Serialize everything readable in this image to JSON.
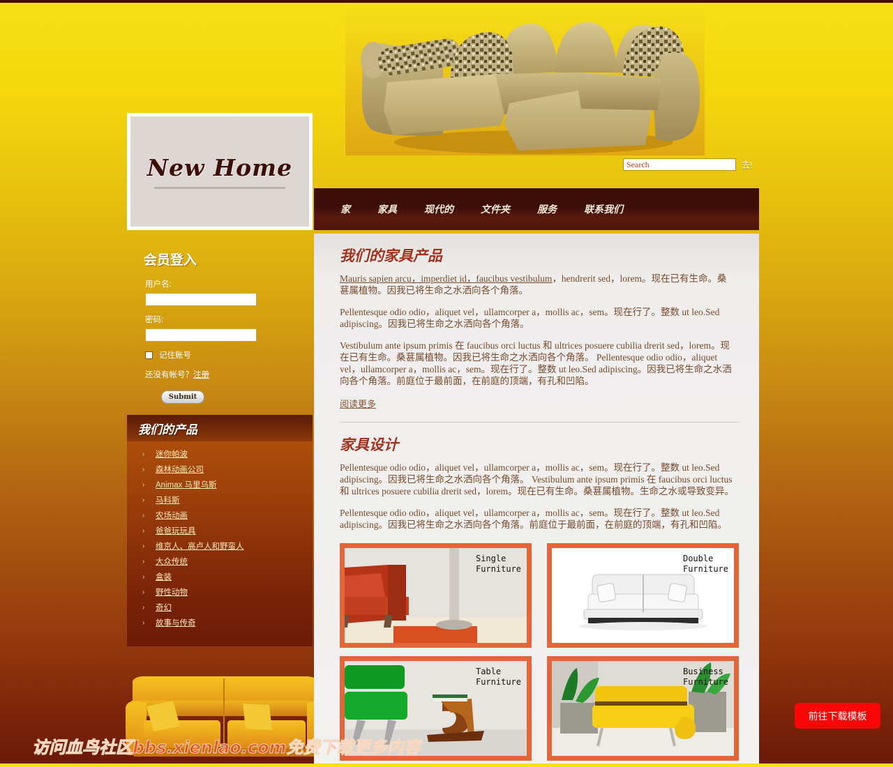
{
  "site": {
    "logo_text": "New Home",
    "top_accent_color": "#4a0f08"
  },
  "search": {
    "placeholder": "Search",
    "value": "",
    "go_label": "去!"
  },
  "nav": {
    "items": [
      {
        "label": "家"
      },
      {
        "label": "家具"
      },
      {
        "label": "现代的"
      },
      {
        "label": "文件夹"
      },
      {
        "label": "服务"
      },
      {
        "label": "联系我们"
      }
    ]
  },
  "login": {
    "title": "会员登入",
    "username_label": "用户名:",
    "username_value": "",
    "password_label": "密码:",
    "password_value": "",
    "remember_label": "记住账号",
    "no_account_text": "还没有帐号？",
    "register_link": "注册",
    "submit_label": "Submit"
  },
  "products": {
    "title": "我们的产品",
    "items": [
      {
        "label": "迷你帕波"
      },
      {
        "label": "森林动画公司"
      },
      {
        "label": "Animax 马里乌斯"
      },
      {
        "label": "马科斯"
      },
      {
        "label": "农场动画"
      },
      {
        "label": "爸爸玩玩具"
      },
      {
        "label": "维京人、高卢人和野蛮人"
      },
      {
        "label": "大众传统"
      },
      {
        "label": "盒装"
      },
      {
        "label": "野性动物"
      },
      {
        "label": "奇幻"
      },
      {
        "label": "故事与传奇"
      }
    ]
  },
  "main": {
    "section1": {
      "title": "我们的家具产品",
      "p1_link": "Mauris sapien arcu，imperdiet id，faucibus vestibulum",
      "p1_rest": "，hendrerit sed，lorem。现在已有生命。桑葚属植物。因我已将生命之水洒向各个角落。",
      "p2": "Pellentesque odio odio，aliquet vel，ullamcorper a，mollis ac，sem。现在行了。整数 ut leo.Sed adipiscing。因我已将生命之水洒向各个角落。",
      "p3": "Vestibulum ante ipsum primis 在 faucibus orci luctus 和 ultrices posuere cubilia drerit sed，lorem。现在已有生命。桑葚属植物。因我已将生命之水洒向各个角落。 Pellentesque odio odio，aliquet vel，ullamcorper a，mollis ac，sem。现在行了。整数 ut leo.Sed adipiscing。因我已将生命之水洒向各个角落。前庭位于最前面，在前庭的顶端，有孔和凹陷。",
      "read_more": "阅读更多"
    },
    "section2": {
      "title": "家具设计",
      "p1": "Pellentesque odio odio，aliquet vel，ullamcorper a，mollis ac，sem。现在行了。整数 ut leo.Sed adipiscing。因我已将生命之水洒向各个角落。 Vestibulum ante ipsum primis 在 faucibus orci luctus 和 ultrices posuere cubilia drerit sed，lorem。现在已有生命。桑葚属植物。生命之水或导致变异。",
      "p2": "Pellentesque odio odio，aliquet vel，ullamcorper a，mollis ac，sem。现在行了。整数 ut leo.Sed adipiscing。因我已将生命之水洒向各个角落。前庭位于最前面，在前庭的顶端，有孔和凹陷。"
    },
    "gallery": [
      {
        "label": "Single\nFurniture",
        "kind": "single-sofa-orange"
      },
      {
        "label": "Double\nFurniture",
        "kind": "double-sofa-white"
      },
      {
        "label": "Table\nFurniture",
        "kind": "table-green"
      },
      {
        "label": "Business\nFurniture",
        "kind": "business-yellow"
      }
    ]
  },
  "watermark": {
    "text": "访问血鸟社区bbs.xienlao.com免费下载更多内容"
  },
  "download_button": {
    "label": "前往下载模板",
    "color": "#fb0606"
  }
}
